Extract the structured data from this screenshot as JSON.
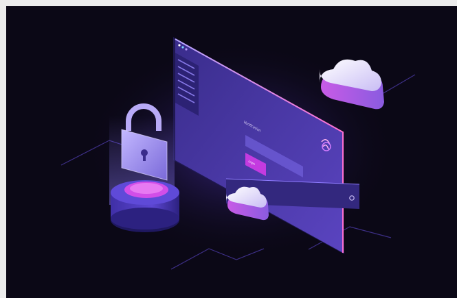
{
  "illustration": {
    "palette": {
      "background": "#0b0816",
      "frame": "#ececec",
      "panel": "#4a3aa6",
      "accent": "#c43be0",
      "cloud": "#e8e0ff",
      "lock": "#9b8cf0"
    },
    "login_panel": {
      "caption": "Verification",
      "button_label": "Login"
    }
  }
}
